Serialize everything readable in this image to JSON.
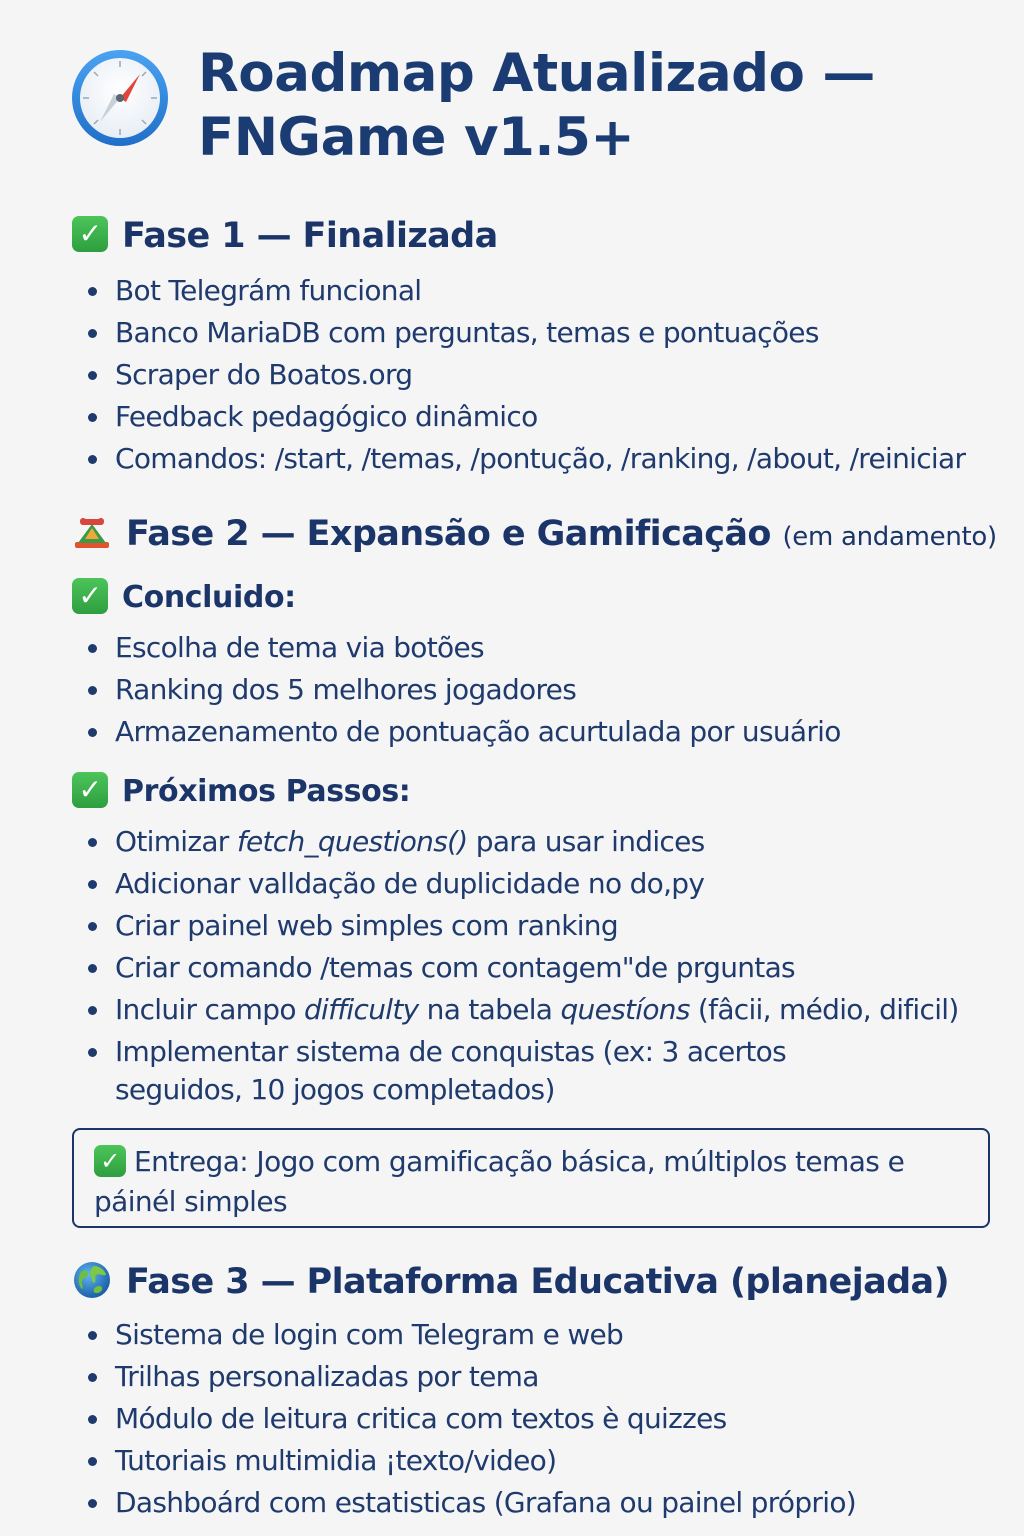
{
  "title": "Roadmap Atualizado — FNGame v1.5+",
  "phase1": {
    "heading": "Fase 1 — Finalizada",
    "items": [
      "Bot Telegrám funcional",
      "Banco MariaDB com perguntas, temas e pontuações",
      "Scraper do Boatos.org",
      "Feedback pedagógico dinâmico",
      "Comandos: /start, /temas, /pontução, /ranking, /about, /reiniciar"
    ]
  },
  "phase2": {
    "heading": "Fase 2 — Expansão e Gamificação",
    "status": "(em andamento)",
    "done_heading": "Concluido:",
    "done_items": [
      "Escolha de tema via botões",
      "Ranking dos 5 melhores jogadores",
      "Armazenamento de pontuação acurtulada por usuário"
    ],
    "next_heading": "Próximos Passos:",
    "next_items": {
      "i0_pre": "Otimizar ",
      "i0_em": "fetch_questions()",
      "i0_post": " para usar indices",
      "i1": "Adicionar valldação de duplicidade no do,py",
      "i2": "Criar painel web simples com ranking",
      "i3": "Criar comando /temas com contagem\"de prguntas",
      "i4_pre": "Incluir campo ",
      "i4_em1": "difficulty",
      "i4_mid": " na tabela ",
      "i4_em2": "questíons",
      "i4_post": " (fâcii, médio, dificil)",
      "i5": "Implementar sistema de conquistas (ex: 3 acertos seguidos, 10 jogos completados)"
    },
    "delivery": "Entrega: Jogo com gamificação básica, múltiplos temas e páinél simples"
  },
  "phase3": {
    "heading": "Fase 3 — Plataforma Educativa (planejada)",
    "items": [
      "Sistema de login com Telegram e web",
      "Trilhas personalizadas por tema",
      "Módulo de leitura critica com textos è quizzes",
      "Tutoriais multimidia ¡texto/video)",
      "Dashboárd com estatisticas (Grafana ou painel próprio)"
    ]
  },
  "icons": {
    "title": "compass-icon",
    "phase1": "check-mark-icon",
    "phase2": "cake-icon",
    "done": "check-mark-icon",
    "next": "check-mark-icon",
    "delivery": "check-mark-icon",
    "phase3": "globe-icon"
  },
  "colors": {
    "heading": "#1b3c73",
    "text": "#1f3a6c",
    "check": "#3bb34a",
    "background": "#f5f5f6"
  }
}
